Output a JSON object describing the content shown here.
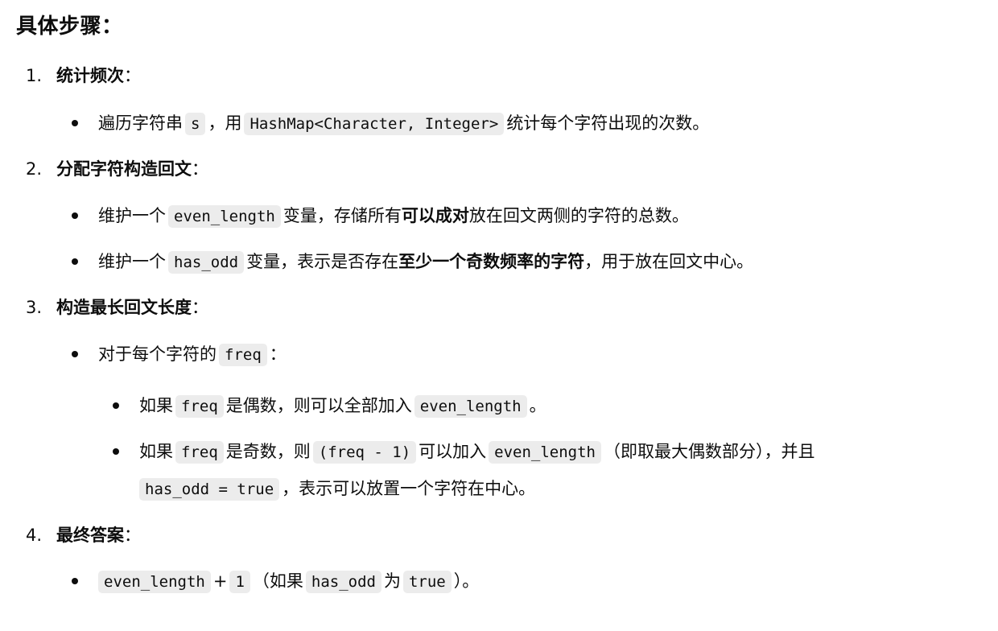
{
  "heading": "具体步骤：",
  "steps": [
    {
      "number": "1.",
      "title": "统计频次",
      "colon": "：",
      "bullets": [
        {
          "t1": "遍历字符串",
          "c1": "s",
          "t2": "，用",
          "c2": "HashMap<Character, Integer>",
          "t3": "统计每个字符出现的次数。"
        }
      ]
    },
    {
      "number": "2.",
      "title": "分配字符构造回文",
      "colon": "：",
      "bullets": [
        {
          "t1": "维护一个",
          "c1": "even_length",
          "t2": "变量，存储所有",
          "b1": "可以成对",
          "t3": "放在回文两侧的字符的总数。"
        },
        {
          "t1": "维护一个",
          "c1": "has_odd",
          "t2": "变量，表示是否存在",
          "b1": "至少一个奇数频率的字符",
          "t3": "，用于放在回文中心。"
        }
      ]
    },
    {
      "number": "3.",
      "title": "构造最长回文长度",
      "colon": "：",
      "bullets": [
        {
          "t1": "对于每个字符的",
          "c1": "freq",
          "t2": "：",
          "sub": [
            {
              "t1": "如果",
              "c1": "freq",
              "t2": "是偶数，则可以全部加入",
              "c2": "even_length",
              "t3": "。"
            },
            {
              "t1": "如果",
              "c1": "freq",
              "t2": "是奇数，则",
              "c2": "(freq - 1)",
              "t3": "可以加入",
              "c3": "even_length",
              "t4": "（即取最大偶数部分），并且",
              "c4": "has_odd = true",
              "t5": "，表示可以放置一个字符在中心。"
            }
          ]
        }
      ]
    },
    {
      "number": "4.",
      "title": "最终答案",
      "colon": "：",
      "bullets": [
        {
          "c1": "even_length",
          "t1": "+",
          "c2": "1",
          "t2": "（如果",
          "c3": "has_odd",
          "t3": "为",
          "c4": "true",
          "t4": "）。"
        }
      ]
    }
  ]
}
